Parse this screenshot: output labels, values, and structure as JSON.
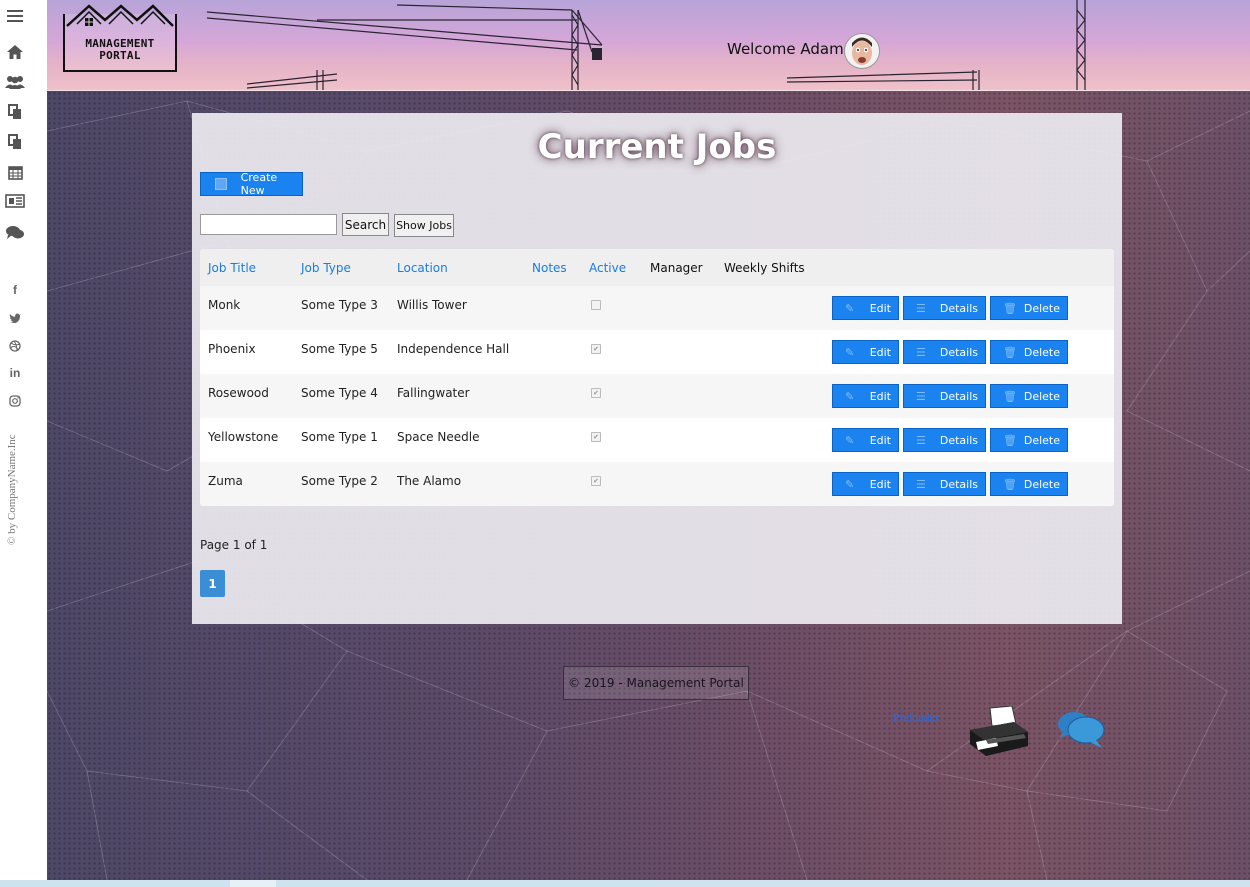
{
  "sidebar": {
    "icons": [
      {
        "name": "menu-icon",
        "glyph": "≡"
      },
      {
        "name": "home-icon",
        "glyph": "⌂"
      },
      {
        "name": "users-icon",
        "glyph": "👥"
      },
      {
        "name": "copy-icon",
        "glyph": "⧉"
      },
      {
        "name": "files-icon",
        "glyph": "⧉"
      },
      {
        "name": "calendar-icon",
        "glyph": "▦"
      },
      {
        "name": "newspaper-icon",
        "glyph": "▤"
      },
      {
        "name": "comments-icon",
        "glyph": "💬"
      }
    ],
    "social": [
      {
        "name": "facebook-icon",
        "glyph": "f"
      },
      {
        "name": "twitter-icon",
        "glyph": "🐦"
      },
      {
        "name": "dribbble-icon",
        "glyph": "⊛"
      },
      {
        "name": "linkedin-icon",
        "glyph": "in"
      },
      {
        "name": "instagram-icon",
        "glyph": "◎"
      }
    ],
    "copyright": "© by CompanyName.Inc"
  },
  "header": {
    "logo_line1": "MANAGEMENT",
    "logo_line2": "PORTAL",
    "welcome": "Welcome Adam I"
  },
  "main": {
    "title": "Current Jobs",
    "create_new": "Create New",
    "search_placeholder": "",
    "search_label": "Search",
    "show_jobs_label": "Show Jobs",
    "columns": {
      "job_title": "Job Title",
      "job_type": "Job Type",
      "location": "Location",
      "notes": "Notes",
      "active": "Active",
      "manager": "Manager",
      "weekly_shifts": "Weekly Shifts"
    },
    "rows": [
      {
        "title": "Monk",
        "type": "Some Type 3",
        "location": "Willis Tower",
        "active": false
      },
      {
        "title": "Phoenix",
        "type": "Some Type 5",
        "location": "Independence Hall",
        "active": true
      },
      {
        "title": "Rosewood",
        "type": "Some Type 4",
        "location": "Fallingwater",
        "active": true
      },
      {
        "title": "Yellowstone",
        "type": "Some Type 1",
        "location": "Space Needle",
        "active": true
      },
      {
        "title": "Zuma",
        "type": "Some Type 2",
        "location": "The Alamo",
        "active": true
      }
    ],
    "actions": {
      "edit": "Edit",
      "details": "Details",
      "delete": "Delete"
    },
    "page_info": "Page 1 of 1",
    "current_page": "1"
  },
  "footer": {
    "text": "© 2019 - Management Portal",
    "preloader": "Preloader"
  },
  "colors": {
    "primary": "#1a83f0",
    "link": "#1a7ce0",
    "pager": "#3a8ed6"
  }
}
